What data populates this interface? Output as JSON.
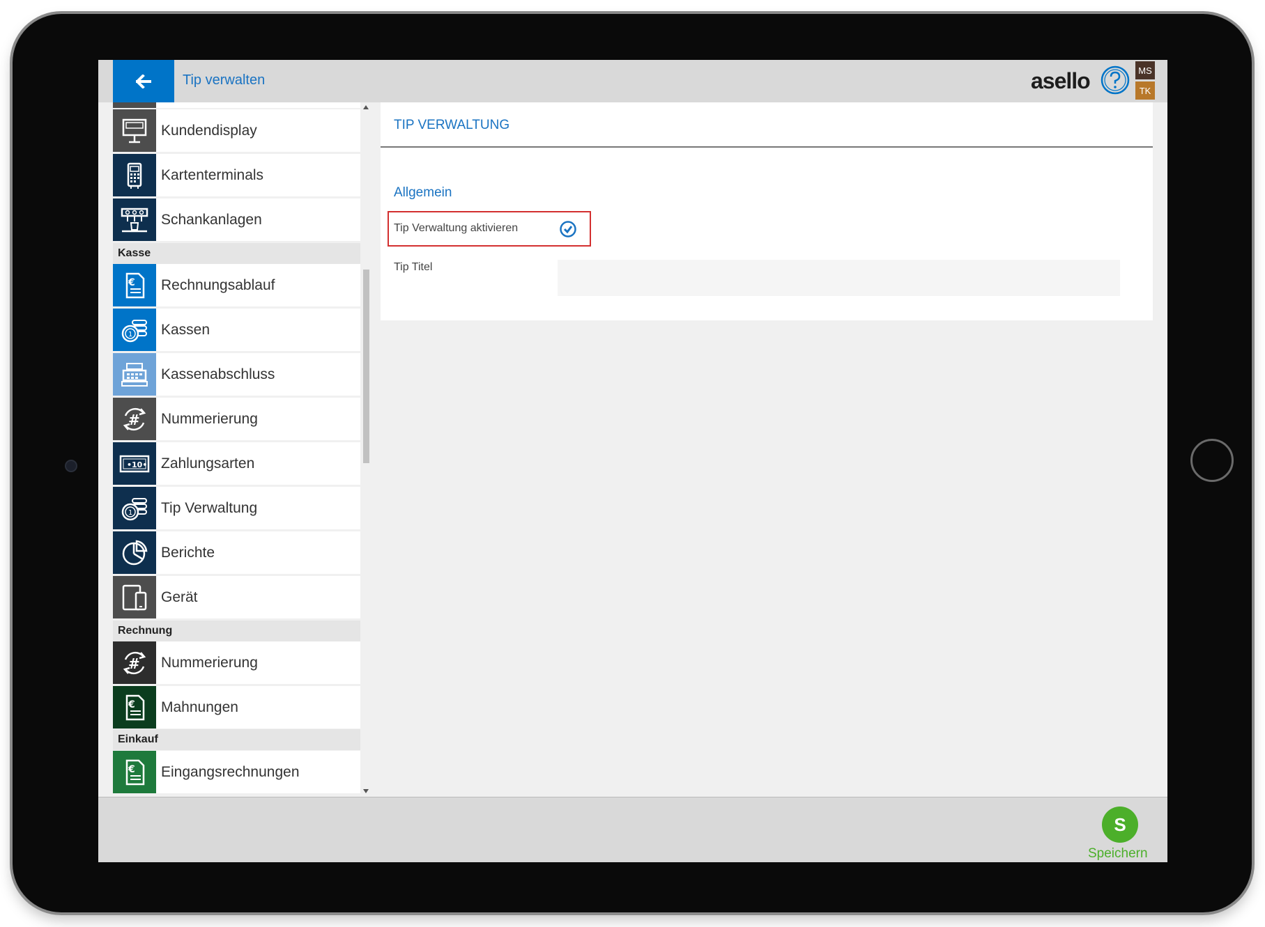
{
  "header": {
    "title": "Tip verwalten",
    "logo": "asello",
    "user_badge_1": "MS",
    "user_badge_2": "TK"
  },
  "sidebar": {
    "items": [
      {
        "label": "Kundendisplay",
        "icon": "customer-display-icon",
        "color": "#4d4d4d"
      },
      {
        "label": "Kartenterminals",
        "icon": "card-terminal-icon",
        "color": "#0e2f4e"
      },
      {
        "label": "Schankanlagen",
        "icon": "tap-system-icon",
        "color": "#0e2f4e"
      },
      {
        "label": "Rechnungsablauf",
        "icon": "invoice-icon",
        "color": "#0074c8"
      },
      {
        "label": "Kassen",
        "icon": "coins-icon",
        "color": "#0074c8"
      },
      {
        "label": "Kassenabschluss",
        "icon": "cash-register-icon",
        "color": "#6ea3d8"
      },
      {
        "label": "Nummerierung",
        "icon": "hash-cycle-icon",
        "color": "#4d4d4d"
      },
      {
        "label": "Zahlungsarten",
        "icon": "banknote-icon",
        "color": "#0e2f4e"
      },
      {
        "label": "Tip Verwaltung",
        "icon": "coins-icon",
        "color": "#0e2f4e"
      },
      {
        "label": "Berichte",
        "icon": "pie-chart-icon",
        "color": "#0e2f4e"
      },
      {
        "label": "Gerät",
        "icon": "devices-icon",
        "color": "#4d4d4d"
      },
      {
        "label": "Nummerierung",
        "icon": "hash-cycle-icon",
        "color": "#2d2d2d"
      },
      {
        "label": "Mahnungen",
        "icon": "invoice-icon",
        "color": "#0b3d1e"
      },
      {
        "label": "Eingangsrechnungen",
        "icon": "invoice-icon",
        "color": "#1e7a3c"
      }
    ],
    "sections": {
      "kasse": "Kasse",
      "rechnung": "Rechnung",
      "einkauf": "Einkauf"
    }
  },
  "panel": {
    "title": "TIP VERWALTUNG",
    "group_title": "Allgemein",
    "field_activate_label": "Tip Verwaltung aktivieren",
    "field_activate_value": true,
    "field_title_label": "Tip Titel",
    "field_title_value": ""
  },
  "footer": {
    "save_icon_letter": "S",
    "save_label": "Speichern"
  },
  "colors": {
    "accent_blue": "#1a73c2",
    "back_button": "#0074c8",
    "save_green": "#4caf2a",
    "highlight_red": "#d32f2f"
  }
}
